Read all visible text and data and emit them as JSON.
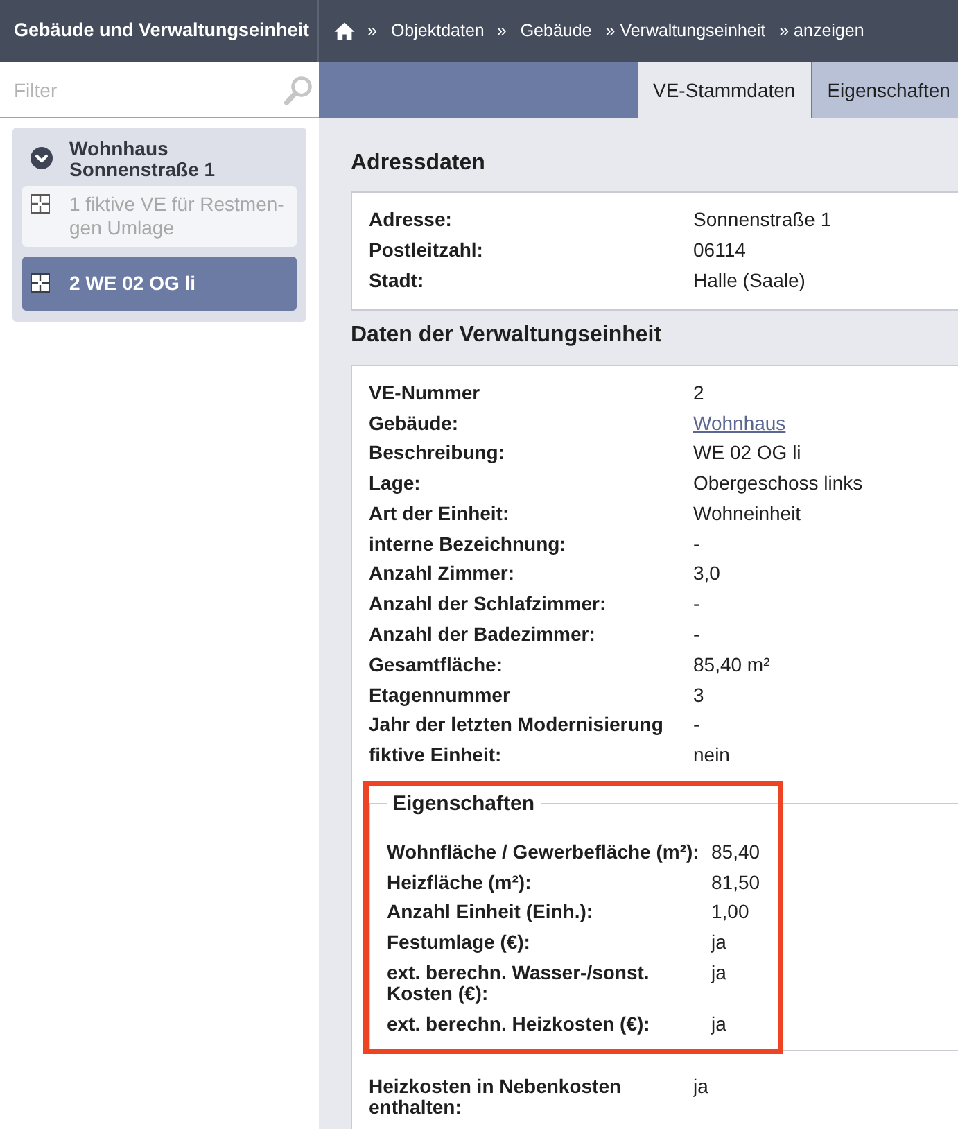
{
  "header": {
    "title": "Gebäude und Verwaltungseinheit",
    "breadcrumb": [
      {
        "kind": "home"
      },
      {
        "kind": "separator",
        "text": "»"
      },
      {
        "kind": "link",
        "text": "Objektdaten"
      },
      {
        "kind": "separator",
        "text": "»"
      },
      {
        "kind": "link",
        "text": "Gebäude"
      },
      {
        "kind": "text",
        "text": "» Verwaltungseinheit"
      },
      {
        "kind": "text",
        "text": "» anzeigen"
      }
    ]
  },
  "filter": {
    "placeholder": "Filter"
  },
  "tabs": [
    {
      "label": "VE-Stammdaten",
      "selected": true
    },
    {
      "label": "Eigenschaften",
      "selected": false
    }
  ],
  "tree": {
    "label": "Wohnhaus Sonnenstraße 1",
    "expanded": true,
    "children": [
      {
        "label": "1 fiktive VE für Restmen-gen Umlage",
        "selected": false
      },
      {
        "label": "2 WE 02 OG li",
        "selected": true
      }
    ]
  },
  "sections": [
    {
      "title": "Adressdaten",
      "rows": [
        {
          "label": "Adresse:",
          "value": "Sonnenstraße 1"
        },
        {
          "label": "Postleitzahl:",
          "value": "06114"
        },
        {
          "label": "Stadt:",
          "value": "Halle (Saale)"
        }
      ]
    },
    {
      "title": "Daten der Verwaltungseinheit",
      "rows": [
        {
          "label": "VE-Nummer",
          "value": "2",
          "kind": "text"
        },
        {
          "label": "Gebäude:",
          "value": "Wohnhaus",
          "kind": "link"
        },
        {
          "label": "Beschreibung:",
          "value": "WE 02 OG li",
          "kind": "text"
        },
        {
          "label": "Lage:",
          "value": "Obergeschoss links",
          "kind": "text"
        },
        {
          "label": "Art der Einheit:",
          "value": "Wohneinheit",
          "kind": "text"
        },
        {
          "label": "interne Bezeichnung:",
          "value": "-",
          "kind": "text"
        },
        {
          "label": "Anzahl Zimmer:",
          "value": "3,0",
          "kind": "text"
        },
        {
          "label": "Anzahl der Schlafzimmer:",
          "value": "-",
          "kind": "text"
        },
        {
          "label": "Anzahl der Badezimmer:",
          "value": "-",
          "kind": "text"
        },
        {
          "label": "Gesamtfläche:",
          "value": "85,40 m²",
          "kind": "text"
        },
        {
          "label": "Etagennummer",
          "value": "3",
          "kind": "text"
        },
        {
          "label": "Jahr der letzten Modernisierung",
          "value": "-",
          "kind": "text"
        },
        {
          "label": "fiktive Einheit:",
          "value": "nein",
          "kind": "text"
        }
      ],
      "fieldset": {
        "legend": "Eigenschaften",
        "highlighted": true,
        "rows": [
          {
            "label": "Wohnfläche / Gewerbefläche (m²):",
            "value": "85,40"
          },
          {
            "label": "Heizfläche (m²):",
            "value": "81,50"
          },
          {
            "label": "Anzahl Einheit (Einh.):",
            "value": "1,00"
          },
          {
            "label": "Festumlage (€):",
            "value": "ja"
          },
          {
            "label": "ext. berechn. Wasser-/sonst. Kosten (€):",
            "value": "ja"
          },
          {
            "label": "ext. berechn. Heizkosten (€):",
            "value": "ja"
          }
        ]
      },
      "rows_after": [
        {
          "label": "Heizkosten in Nebenkosten enthalten:",
          "value": "ja"
        }
      ]
    }
  ]
}
